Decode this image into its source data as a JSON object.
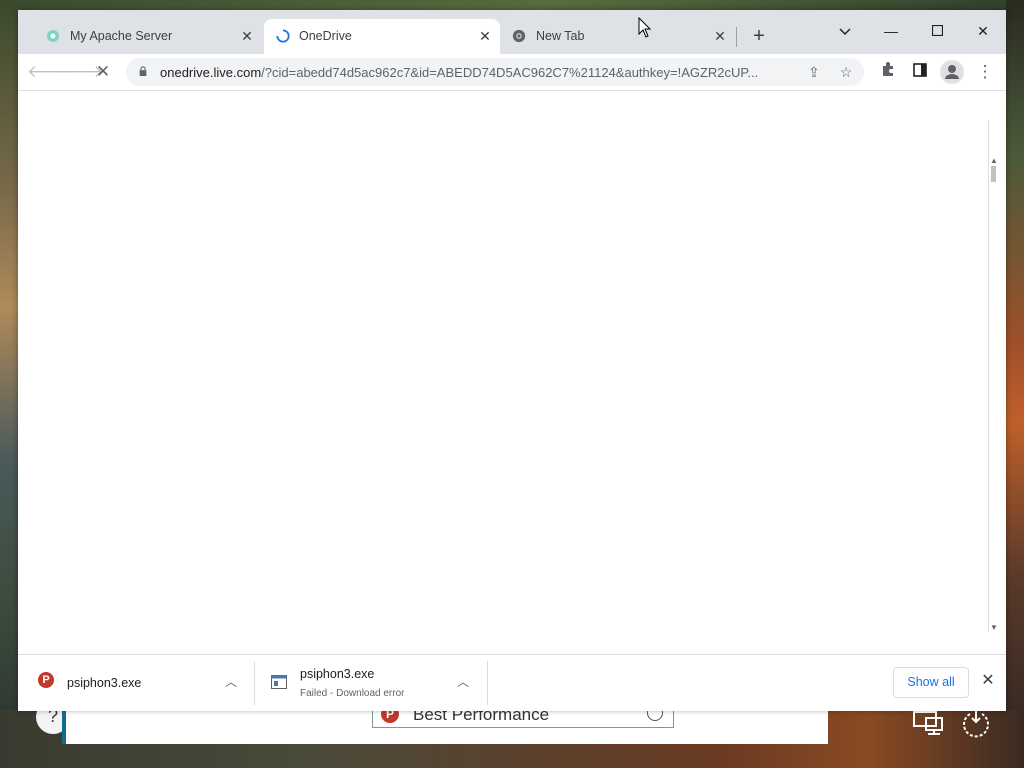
{
  "tabs": [
    {
      "title": "My Apache Server",
      "icon": "apache-icon",
      "active": false
    },
    {
      "title": "OneDrive",
      "icon": "loading-spinner-icon",
      "active": true
    },
    {
      "title": "New Tab",
      "icon": "chrome-icon",
      "active": false
    }
  ],
  "omnibox": {
    "host": "onedrive.live.com",
    "path": "/?cid=abedd74d5ac962c7&id=ABEDD74D5AC962C7%21124&authkey=!AGZR2cUP..."
  },
  "downloads": [
    {
      "name": "psiphon3.exe",
      "status": ""
    },
    {
      "name": "psiphon3.exe",
      "status": "Failed - Download error"
    }
  ],
  "download_bar": {
    "show_all_label": "Show all"
  },
  "background_window": {
    "select_text": "Best Performance",
    "left_glyph": "?"
  },
  "colors": {
    "tabstrip": "#dee1e6",
    "accent_link": "#1a73e8",
    "spinner": "#1a73e8",
    "psiphon_red": "#c0392b"
  }
}
